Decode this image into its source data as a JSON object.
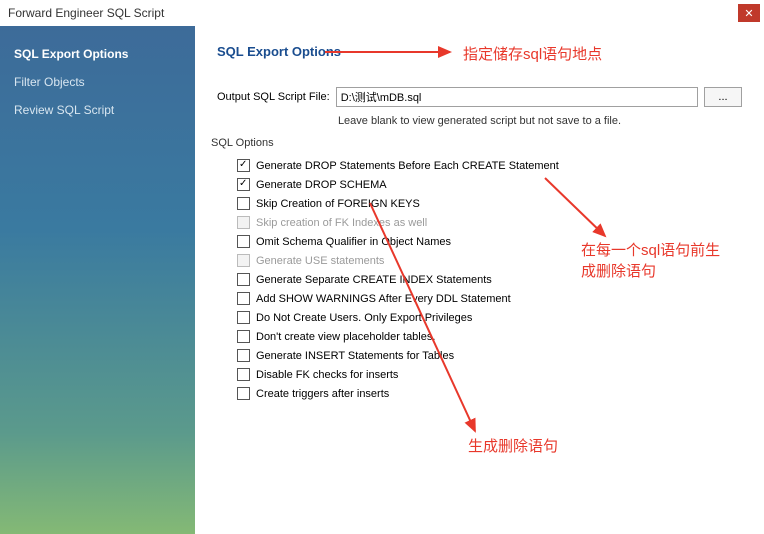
{
  "window": {
    "title": "Forward Engineer SQL Script"
  },
  "sidebar": {
    "items": [
      {
        "label": "SQL Export Options",
        "active": true
      },
      {
        "label": "Filter Objects",
        "active": false
      },
      {
        "label": "Review SQL Script",
        "active": false
      }
    ]
  },
  "main": {
    "section_title": "SQL Export Options",
    "file_label": "Output SQL Script File:",
    "file_value": "D:\\测试\\mDB.sql",
    "browse_label": "...",
    "hint": "Leave blank to view generated script but not save to a file.",
    "fieldset_legend": "SQL Options",
    "options": [
      {
        "label": "Generate DROP Statements Before Each CREATE Statement",
        "checked": true,
        "disabled": false
      },
      {
        "label": "Generate DROP SCHEMA",
        "checked": true,
        "disabled": false
      },
      {
        "label": "Skip Creation of FOREIGN KEYS",
        "checked": false,
        "disabled": false
      },
      {
        "label": "Skip creation of FK Indexes as well",
        "checked": false,
        "disabled": true
      },
      {
        "label": "Omit Schema Qualifier in Object Names",
        "checked": false,
        "disabled": false
      },
      {
        "label": "Generate USE statements",
        "checked": false,
        "disabled": true
      },
      {
        "label": "Generate Separate CREATE INDEX Statements",
        "checked": false,
        "disabled": false
      },
      {
        "label": "Add SHOW WARNINGS After Every DDL Statement",
        "checked": false,
        "disabled": false
      },
      {
        "label": "Do Not Create Users. Only Export Privileges",
        "checked": false,
        "disabled": false
      },
      {
        "label": "Don't create view placeholder tables.",
        "checked": false,
        "disabled": false
      },
      {
        "label": "Generate INSERT Statements for Tables",
        "checked": false,
        "disabled": false
      },
      {
        "label": "Disable FK checks for inserts",
        "checked": false,
        "disabled": false
      },
      {
        "label": "Create triggers after inserts",
        "checked": false,
        "disabled": false
      }
    ]
  },
  "annotations": {
    "a1": "指定储存sql语句地点",
    "a2": "在每一个sql语句前生成删除语句",
    "a3": "生成删除语句"
  }
}
